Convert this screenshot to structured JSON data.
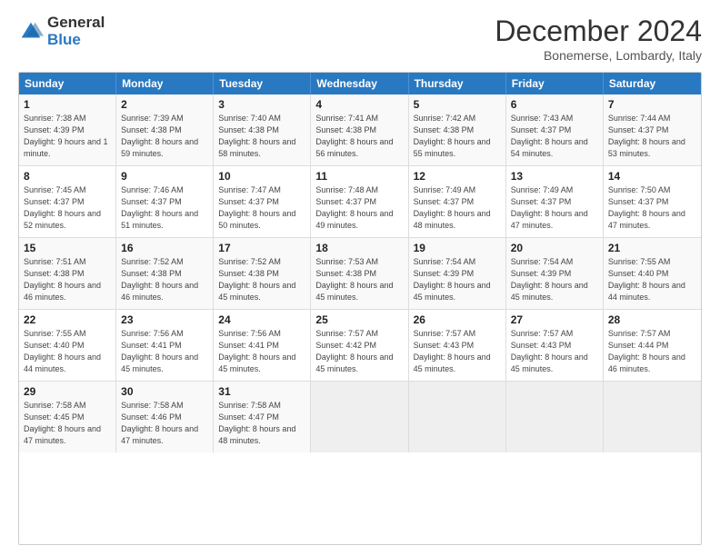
{
  "header": {
    "logo_line1": "General",
    "logo_line2": "Blue",
    "month": "December 2024",
    "location": "Bonemerse, Lombardy, Italy"
  },
  "days_of_week": [
    "Sunday",
    "Monday",
    "Tuesday",
    "Wednesday",
    "Thursday",
    "Friday",
    "Saturday"
  ],
  "weeks": [
    [
      {
        "day": "1",
        "sunrise": "Sunrise: 7:38 AM",
        "sunset": "Sunset: 4:39 PM",
        "daylight": "Daylight: 9 hours and 1 minute."
      },
      {
        "day": "2",
        "sunrise": "Sunrise: 7:39 AM",
        "sunset": "Sunset: 4:38 PM",
        "daylight": "Daylight: 8 hours and 59 minutes."
      },
      {
        "day": "3",
        "sunrise": "Sunrise: 7:40 AM",
        "sunset": "Sunset: 4:38 PM",
        "daylight": "Daylight: 8 hours and 58 minutes."
      },
      {
        "day": "4",
        "sunrise": "Sunrise: 7:41 AM",
        "sunset": "Sunset: 4:38 PM",
        "daylight": "Daylight: 8 hours and 56 minutes."
      },
      {
        "day": "5",
        "sunrise": "Sunrise: 7:42 AM",
        "sunset": "Sunset: 4:38 PM",
        "daylight": "Daylight: 8 hours and 55 minutes."
      },
      {
        "day": "6",
        "sunrise": "Sunrise: 7:43 AM",
        "sunset": "Sunset: 4:37 PM",
        "daylight": "Daylight: 8 hours and 54 minutes."
      },
      {
        "day": "7",
        "sunrise": "Sunrise: 7:44 AM",
        "sunset": "Sunset: 4:37 PM",
        "daylight": "Daylight: 8 hours and 53 minutes."
      }
    ],
    [
      {
        "day": "8",
        "sunrise": "Sunrise: 7:45 AM",
        "sunset": "Sunset: 4:37 PM",
        "daylight": "Daylight: 8 hours and 52 minutes."
      },
      {
        "day": "9",
        "sunrise": "Sunrise: 7:46 AM",
        "sunset": "Sunset: 4:37 PM",
        "daylight": "Daylight: 8 hours and 51 minutes."
      },
      {
        "day": "10",
        "sunrise": "Sunrise: 7:47 AM",
        "sunset": "Sunset: 4:37 PM",
        "daylight": "Daylight: 8 hours and 50 minutes."
      },
      {
        "day": "11",
        "sunrise": "Sunrise: 7:48 AM",
        "sunset": "Sunset: 4:37 PM",
        "daylight": "Daylight: 8 hours and 49 minutes."
      },
      {
        "day": "12",
        "sunrise": "Sunrise: 7:49 AM",
        "sunset": "Sunset: 4:37 PM",
        "daylight": "Daylight: 8 hours and 48 minutes."
      },
      {
        "day": "13",
        "sunrise": "Sunrise: 7:49 AM",
        "sunset": "Sunset: 4:37 PM",
        "daylight": "Daylight: 8 hours and 47 minutes."
      },
      {
        "day": "14",
        "sunrise": "Sunrise: 7:50 AM",
        "sunset": "Sunset: 4:37 PM",
        "daylight": "Daylight: 8 hours and 47 minutes."
      }
    ],
    [
      {
        "day": "15",
        "sunrise": "Sunrise: 7:51 AM",
        "sunset": "Sunset: 4:38 PM",
        "daylight": "Daylight: 8 hours and 46 minutes."
      },
      {
        "day": "16",
        "sunrise": "Sunrise: 7:52 AM",
        "sunset": "Sunset: 4:38 PM",
        "daylight": "Daylight: 8 hours and 46 minutes."
      },
      {
        "day": "17",
        "sunrise": "Sunrise: 7:52 AM",
        "sunset": "Sunset: 4:38 PM",
        "daylight": "Daylight: 8 hours and 45 minutes."
      },
      {
        "day": "18",
        "sunrise": "Sunrise: 7:53 AM",
        "sunset": "Sunset: 4:38 PM",
        "daylight": "Daylight: 8 hours and 45 minutes."
      },
      {
        "day": "19",
        "sunrise": "Sunrise: 7:54 AM",
        "sunset": "Sunset: 4:39 PM",
        "daylight": "Daylight: 8 hours and 45 minutes."
      },
      {
        "day": "20",
        "sunrise": "Sunrise: 7:54 AM",
        "sunset": "Sunset: 4:39 PM",
        "daylight": "Daylight: 8 hours and 45 minutes."
      },
      {
        "day": "21",
        "sunrise": "Sunrise: 7:55 AM",
        "sunset": "Sunset: 4:40 PM",
        "daylight": "Daylight: 8 hours and 44 minutes."
      }
    ],
    [
      {
        "day": "22",
        "sunrise": "Sunrise: 7:55 AM",
        "sunset": "Sunset: 4:40 PM",
        "daylight": "Daylight: 8 hours and 44 minutes."
      },
      {
        "day": "23",
        "sunrise": "Sunrise: 7:56 AM",
        "sunset": "Sunset: 4:41 PM",
        "daylight": "Daylight: 8 hours and 45 minutes."
      },
      {
        "day": "24",
        "sunrise": "Sunrise: 7:56 AM",
        "sunset": "Sunset: 4:41 PM",
        "daylight": "Daylight: 8 hours and 45 minutes."
      },
      {
        "day": "25",
        "sunrise": "Sunrise: 7:57 AM",
        "sunset": "Sunset: 4:42 PM",
        "daylight": "Daylight: 8 hours and 45 minutes."
      },
      {
        "day": "26",
        "sunrise": "Sunrise: 7:57 AM",
        "sunset": "Sunset: 4:43 PM",
        "daylight": "Daylight: 8 hours and 45 minutes."
      },
      {
        "day": "27",
        "sunrise": "Sunrise: 7:57 AM",
        "sunset": "Sunset: 4:43 PM",
        "daylight": "Daylight: 8 hours and 45 minutes."
      },
      {
        "day": "28",
        "sunrise": "Sunrise: 7:57 AM",
        "sunset": "Sunset: 4:44 PM",
        "daylight": "Daylight: 8 hours and 46 minutes."
      }
    ],
    [
      {
        "day": "29",
        "sunrise": "Sunrise: 7:58 AM",
        "sunset": "Sunset: 4:45 PM",
        "daylight": "Daylight: 8 hours and 47 minutes."
      },
      {
        "day": "30",
        "sunrise": "Sunrise: 7:58 AM",
        "sunset": "Sunset: 4:46 PM",
        "daylight": "Daylight: 8 hours and 47 minutes."
      },
      {
        "day": "31",
        "sunrise": "Sunrise: 7:58 AM",
        "sunset": "Sunset: 4:47 PM",
        "daylight": "Daylight: 8 hours and 48 minutes."
      },
      {
        "day": "",
        "sunrise": "",
        "sunset": "",
        "daylight": ""
      },
      {
        "day": "",
        "sunrise": "",
        "sunset": "",
        "daylight": ""
      },
      {
        "day": "",
        "sunrise": "",
        "sunset": "",
        "daylight": ""
      },
      {
        "day": "",
        "sunrise": "",
        "sunset": "",
        "daylight": ""
      }
    ]
  ]
}
